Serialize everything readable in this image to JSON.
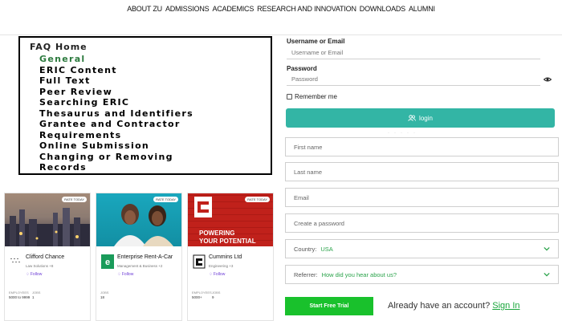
{
  "topnav": [
    "ABOUT ZU",
    "ADMISSIONS",
    "ACADEMICS",
    "RESEARCH AND INNOVATION",
    "DOWNLOADS",
    "ALUMNI"
  ],
  "faq": {
    "home": "FAQ Home",
    "items": [
      "General",
      "ERIC Content",
      "Full Text",
      "Peer Review",
      "Searching ERIC",
      "Thesaurus and Identifiers",
      "Grantee and Contractor",
      "Requirements",
      "Online Submission",
      "Changing or Removing",
      "Records"
    ],
    "active_color": "#2c7a3e"
  },
  "cards": [
    {
      "badge": "RATE TODAY",
      "name": "Clifford Chance",
      "sub": "Law Solutions +8",
      "follow": "Follow",
      "stat1_label": "EMPLOYEES",
      "stat1_value": "5000 to 9999",
      "stat2_label": "JOBS",
      "stat2_value": "1"
    },
    {
      "badge": "RATE TODAY",
      "name": "Enterprise Rent-A-Car",
      "sub": "Management & Business +2",
      "follow": "Follow",
      "stat1_label": "JOBS",
      "stat1_value": "18",
      "stat2_label": "",
      "stat2_value": ""
    },
    {
      "badge": "RATE TODAY",
      "name": "Cummins Ltd",
      "sub": "Engineering +3",
      "follow": "Follow",
      "stat1_label": "EMPLOYEES",
      "stat1_value": "5000+",
      "stat2_label": "JOBS",
      "stat2_value": "9",
      "banner_text": [
        "POWERING",
        "YOUR POTENTIAL"
      ]
    }
  ],
  "login": {
    "username_label": "Username or Email",
    "username_placeholder": "Username or Email",
    "password_label": "Password",
    "password_placeholder": "Password",
    "remember": "Remember me",
    "button": "login",
    "accent": "#33b5a5"
  },
  "signup": {
    "first_name": "First name",
    "last_name": "Last name",
    "email": "Email",
    "password": "Create a password",
    "country_label": "Country:",
    "country_value": "USA",
    "referrer_label": "Referrer:",
    "referrer_value": "How did you hear about us?",
    "trial_button": "Start Free Trial",
    "already": "Already have an account?",
    "signin": "Sign In",
    "accent": "#19c12c"
  }
}
